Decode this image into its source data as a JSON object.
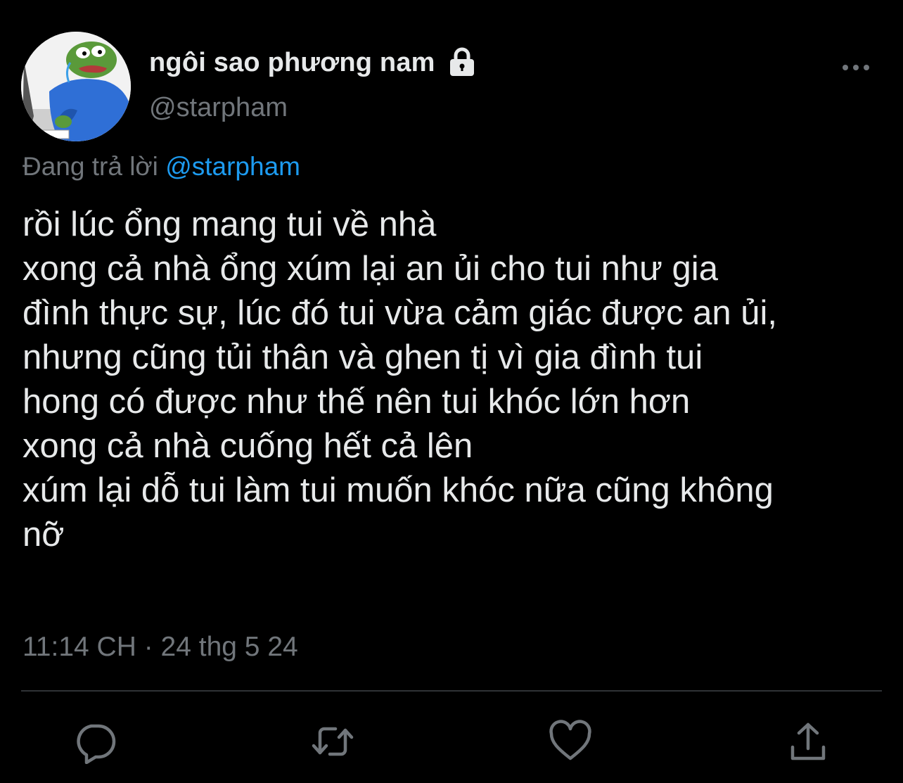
{
  "profile": {
    "display_name": "ngôi sao phương nam",
    "handle": "@starpham",
    "protected": true
  },
  "reply_context": {
    "prefix": "Đang trả lời",
    "handle": "@starpham"
  },
  "tweet": {
    "lines": [
      "rồi lúc ổng mang tui về nhà",
      "xong cả nhà ổng xúm lại an ủi cho tui như gia",
      "đình thực sự, lúc đó tui vừa cảm giác được an ủi,",
      "nhưng cũng tủi thân và ghen tị vì gia đình tui",
      "hong có được như thế nên tui khóc lớn hơn",
      "xong cả nhà cuống hết cả lên",
      "xúm lại dỗ tui làm tui muốn khóc nữa cũng không",
      "nỡ"
    ],
    "timestamp": "11:14 CH · 24 thg 5 24"
  },
  "actions": {
    "icons": [
      "reply-icon",
      "retweet-icon",
      "like-icon",
      "share-icon"
    ]
  },
  "colors": {
    "background": "#000000",
    "text_primary": "#e7e9ea",
    "text_secondary": "#71767b",
    "accent": "#1d9bf0",
    "divider": "#2f3336"
  }
}
